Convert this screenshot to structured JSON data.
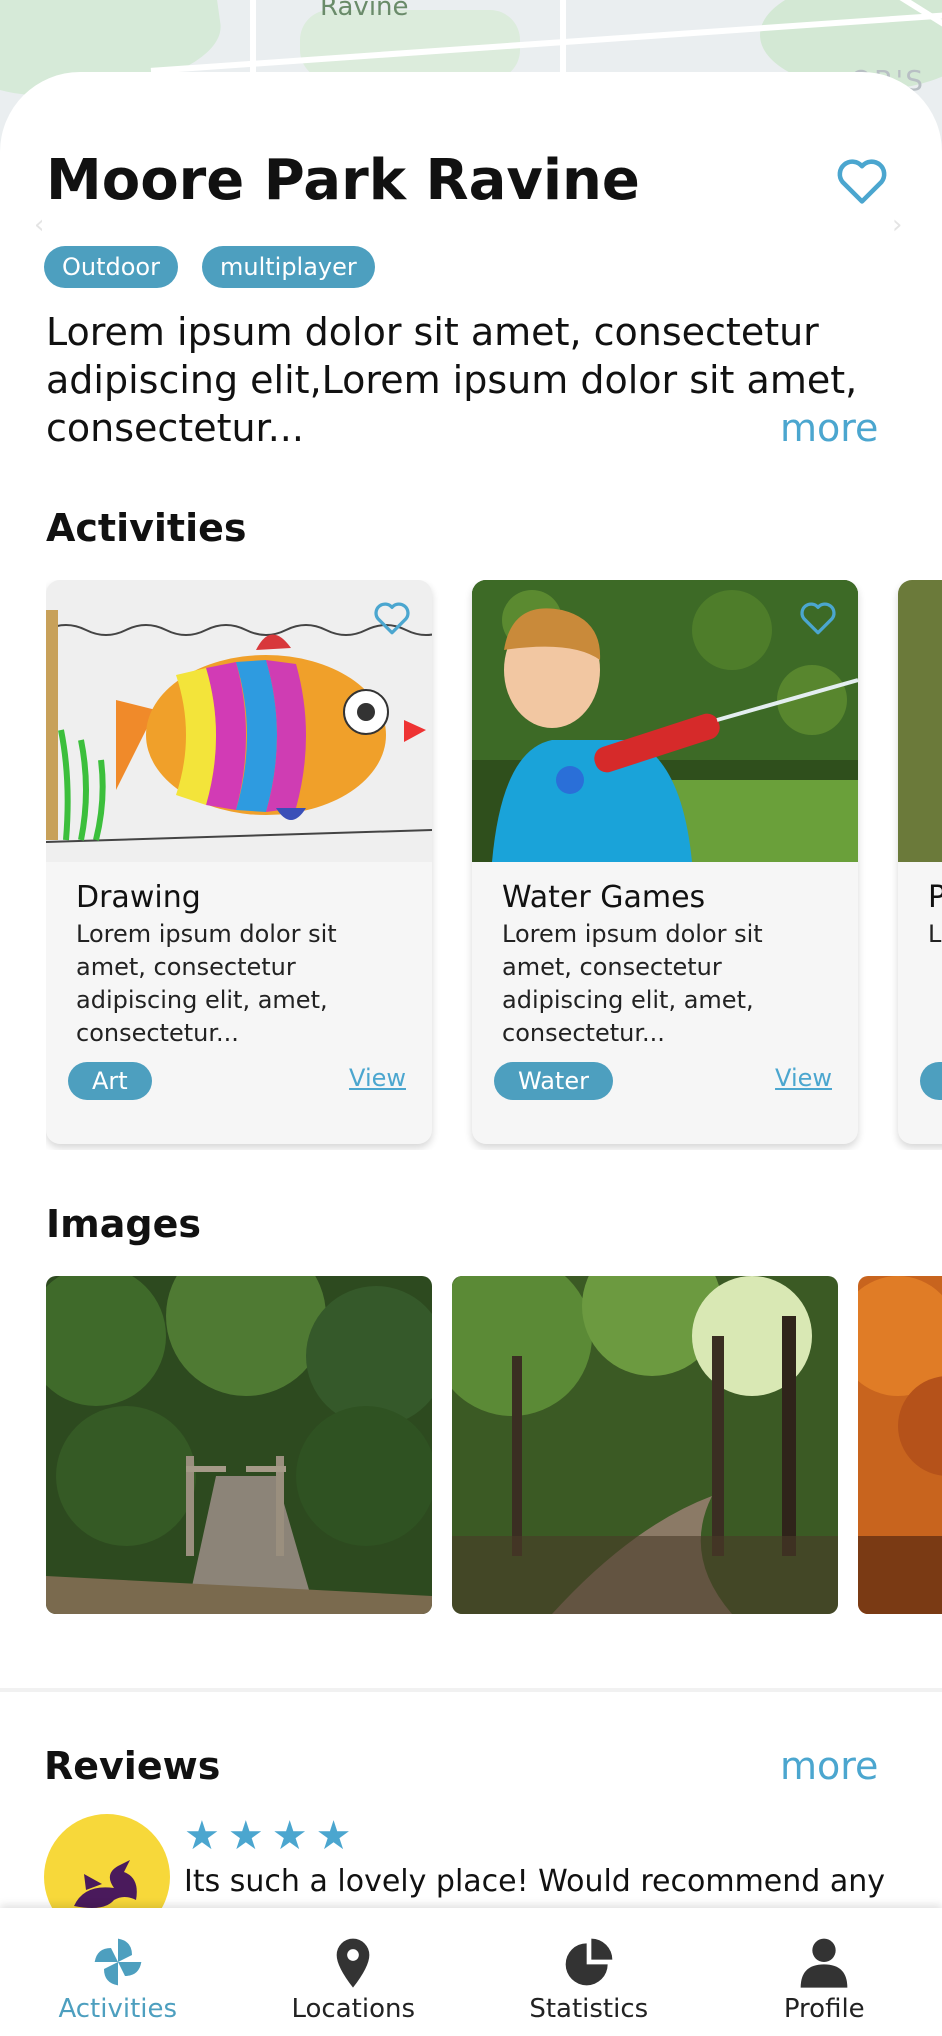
{
  "map": {
    "area_label": "Ravine",
    "corner_label": "OR'S"
  },
  "place": {
    "title": "Moore Park Ravine",
    "tags": [
      "Outdoor",
      "multiplayer"
    ],
    "description": "Lorem ipsum dolor sit amet, consectetur adipiscing elit,Lorem ipsum dolor sit amet, consectetur...",
    "more_label": "more",
    "favorite_icon": "heart-outline-icon"
  },
  "activities": {
    "heading": "Activities",
    "cards": [
      {
        "name": "Drawing",
        "text": "Lorem ipsum dolor sit amet, consectetur adipiscing elit, amet, consectetur...",
        "tag": "Art",
        "view_label": "View"
      },
      {
        "name": "Water Games",
        "text": "Lorem ipsum dolor sit amet, consectetur adipiscing elit, amet, consectetur...",
        "tag": "Water",
        "view_label": "View"
      },
      {
        "name": "P",
        "text": "L a a c",
        "tag": "",
        "view_label": ""
      }
    ]
  },
  "images": {
    "heading": "Images"
  },
  "reviews": {
    "heading": "Reviews",
    "more_label": "more",
    "items": [
      {
        "rating": 4,
        "text": "Its such a lovely place! Would recommend any"
      }
    ]
  },
  "nav": {
    "items": [
      {
        "label": "Activities",
        "icon": "pinwheel-icon",
        "active": true
      },
      {
        "label": "Locations",
        "icon": "map-pin-icon",
        "active": false
      },
      {
        "label": "Statistics",
        "icon": "pie-chart-icon",
        "active": false
      },
      {
        "label": "Profile",
        "icon": "person-icon",
        "active": false
      }
    ]
  },
  "colors": {
    "accent": "#4BA6CF",
    "chip": "#4D9FBF",
    "avatar_bg": "#F7D83A"
  }
}
